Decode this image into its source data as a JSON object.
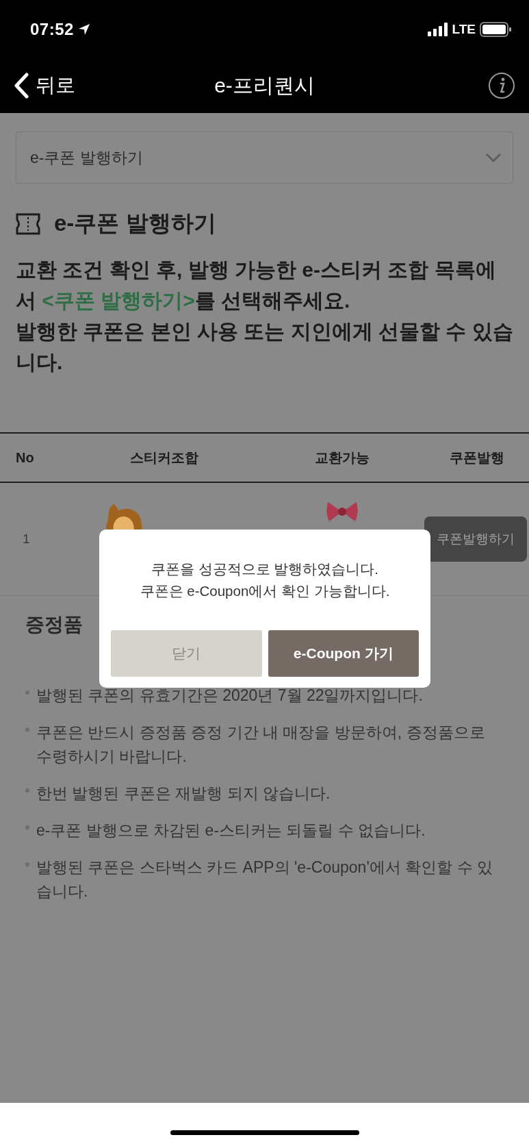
{
  "status_bar": {
    "time": "07:52",
    "network": "LTE"
  },
  "nav": {
    "back": "뒤로",
    "title": "e-프리퀀시"
  },
  "dropdown": {
    "value": "e-쿠폰 발행하기"
  },
  "section": {
    "title": "e-쿠폰 발행하기",
    "intro": [
      {
        "text": "교환 조건 확인 후, 발행 가능한 e-스티커 조합 목록에서 ",
        "highlight": false
      },
      {
        "text": "<쿠폰 발행하기>",
        "highlight": true
      },
      {
        "text": "를 선택해주세요.",
        "highlight": false
      }
    ],
    "note": "발행한 쿠폰은 본인 사용 또는 지인에게 선물할 수 있습니다."
  },
  "table": {
    "columns": [
      "No",
      "스티커조합",
      "교환가능",
      "쿠폰발행"
    ],
    "rows": [
      {
        "no": "1",
        "button": "쿠폰발행하기"
      }
    ]
  },
  "notice": {
    "title": "증정품",
    "items": [
      "발행된 쿠폰의 유효기간은 2020년 7월 22일까지입니다.",
      "쿠폰은 반드시 증정품 증정 기간 내 매장을 방문하여, 증정품으로 수령하시기 바랍니다.",
      "한번 발행된 쿠폰은 재발행 되지 않습니다.",
      "e-쿠폰 발행으로 차감된 e-스티커는 되돌릴 수 없습니다.",
      "발행된 쿠폰은 스타벅스 카드 APP의 'e-Coupon'에서 확인할 수 있습니다."
    ]
  },
  "dialog": {
    "message": [
      "쿠폰을 성공적으로 발행하였습니다.",
      "쿠폰은 e-Coupon에서 확인 가능합니다."
    ],
    "buttons": [
      {
        "label": "닫기",
        "kind": "secondary"
      },
      {
        "label": "e-Coupon 가기",
        "kind": "primary"
      }
    ]
  }
}
